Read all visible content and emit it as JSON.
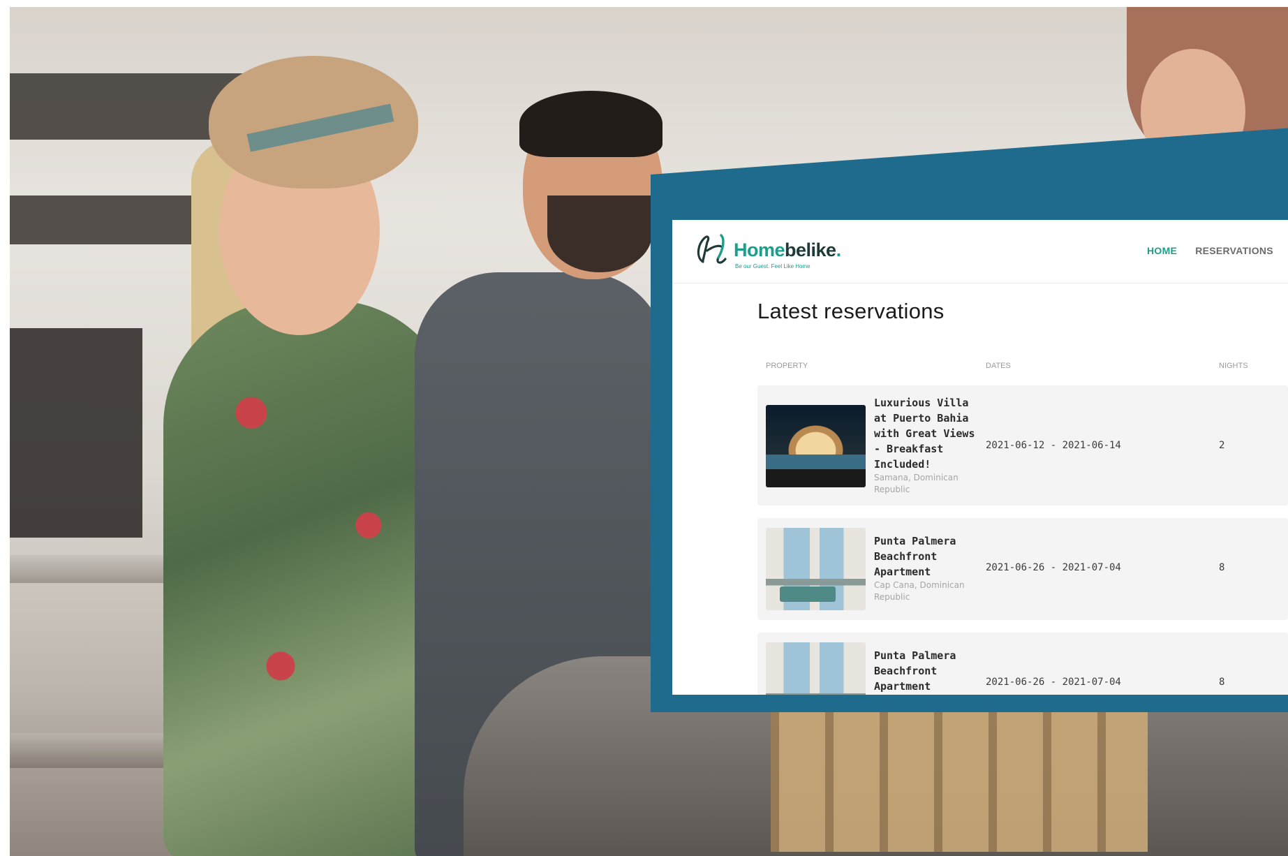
{
  "app": {
    "brand_part1": "Home",
    "brand_part2": "belike",
    "brand_dot": ".",
    "tagline": "Be our Guest. Feel Like Home"
  },
  "nav": {
    "items": [
      {
        "label": "HOME",
        "active": true
      },
      {
        "label": "RESERVATIONS",
        "active": false
      }
    ]
  },
  "page": {
    "title": "Latest reservations"
  },
  "table": {
    "columns": [
      "PROPERTY",
      "DATES",
      "NIGHTS"
    ],
    "rows": [
      {
        "name": "Luxurious Villa at Puerto Bahia with Great Views - Breakfast Included!",
        "location": "Samana, Dominican Republic",
        "dates": "2021-06-12 - 2021-06-14",
        "nights": "2"
      },
      {
        "name": "Punta Palmera Beachfront Apartment",
        "location": "Cap Cana, Dominican Republic",
        "dates": "2021-06-26 - 2021-07-04",
        "nights": "8"
      },
      {
        "name": "Punta Palmera Beachfront Apartment",
        "location": "",
        "dates": "2021-06-26 - 2021-07-04",
        "nights": "8"
      }
    ]
  },
  "colors": {
    "brand_teal": "#1b9e8a",
    "frame_blue": "#1e6b8e",
    "row_bg": "#f4f4f4"
  }
}
